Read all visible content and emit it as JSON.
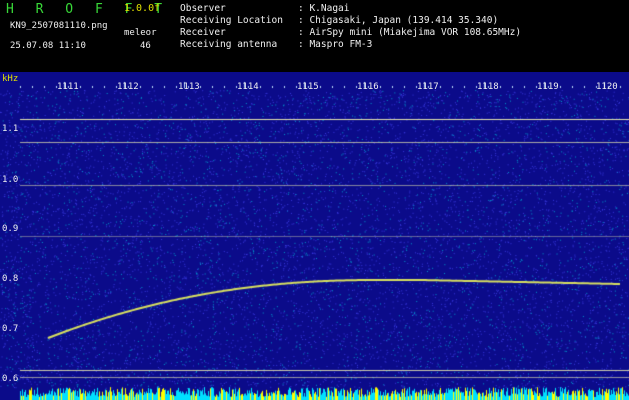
{
  "header": {
    "brand": "H R O F F T",
    "version": "1.0.0f",
    "filename": "KN9_2507081110.png",
    "mode": "meleor",
    "datetime": "25.07.08 11:10",
    "count": "46",
    "info_rows": [
      {
        "label": "Observer",
        "value": ": K.Nagai"
      },
      {
        "label": "Receiving Location",
        "value": ": Chigasaki, Japan (139.414 35.340)"
      },
      {
        "label": "Receiver",
        "value": ": AirSpy mini (Miakejima VOR 108.65MHz)"
      },
      {
        "label": "Receiving antenna",
        "value": ": Maspro FM-3"
      }
    ]
  },
  "axes": {
    "y_unit": "kHz",
    "y_ticks": [
      "1.1",
      "1.0",
      "0.9",
      "0.8",
      "0.7",
      "0.6"
    ],
    "time_ticks": [
      "1111",
      "1112",
      "1113",
      "1114",
      "1115",
      "1116",
      "1117",
      "1118",
      "1119",
      "1120"
    ]
  },
  "colors": {
    "background": "#0b0b8a",
    "noise_a": "#3a3ae0",
    "noise_b": "#00a0d0",
    "trace": "#d8e060",
    "carrier": "#f0f0b0",
    "grid": "#c0e0ff",
    "bottom_bar_a": "#ffff00",
    "bottom_bar_b": "#00e0ff"
  }
}
